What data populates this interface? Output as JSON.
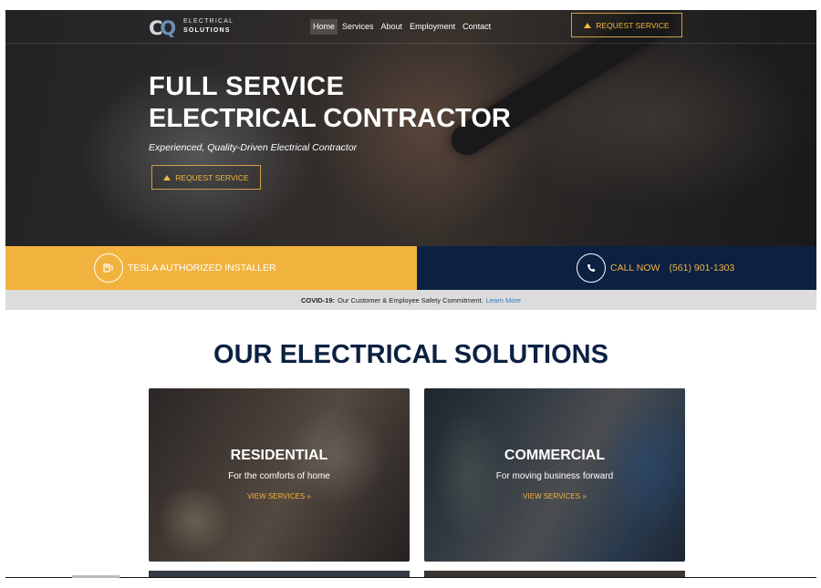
{
  "header": {
    "logo_mark_c": "C",
    "logo_mark_q": "Q",
    "logo_line1": "ELECTRICAL",
    "logo_line2": "SOLUTIONS",
    "nav": [
      "Home",
      "Services",
      "About",
      "Employment",
      "Contact"
    ],
    "request_label": "REQUEST SERVICE"
  },
  "hero": {
    "line1": "FULL SERVICE",
    "line2": "ELECTRICAL CONTRACTOR",
    "subtitle": "Experienced, Quality-Driven Electrical Contractor",
    "cta_label": "REQUEST SERVICE"
  },
  "strip": {
    "left_text": "TESLA AUTHORIZED INSTALLER",
    "call_label": "CALL NOW",
    "phone": "(561) 901-1303",
    "left_color": "#f2b23e",
    "right_color": "#0c2142"
  },
  "covid": {
    "bold": "COVID-19:",
    "text": "Our Customer & Employee Safety Commitment.",
    "link": "Learn More"
  },
  "solutions": {
    "title_light": "OUR",
    "title_bold": "ELECTRICAL SOLUTIONS",
    "cards": [
      {
        "title": "RESIDENTIAL",
        "subtitle": "For the comforts of home",
        "link": "VIEW SERVICES »"
      },
      {
        "title": "COMMERCIAL",
        "subtitle": "For moving business forward",
        "link": "VIEW SERVICES »"
      }
    ]
  },
  "icons": {
    "logo": "cq-logo-icon",
    "request": "warning-triangle-icon",
    "tesla": "ev-plug-icon",
    "phone": "phone-icon"
  }
}
